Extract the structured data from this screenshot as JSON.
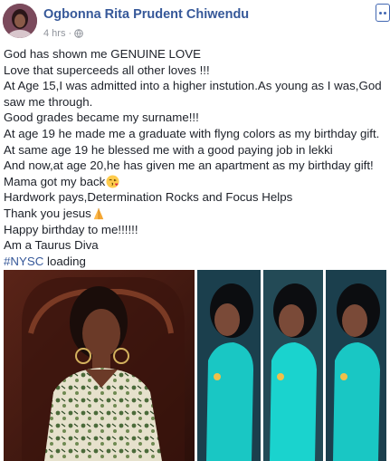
{
  "post": {
    "author": "Ogbonna Rita Prudent Chiwendu",
    "time": "4 hrs",
    "separator": "·",
    "lines": [
      "God has shown me GENUINE LOVE",
      "Love that superceeds all other loves !!!",
      "At Age 15,I was admitted into a higher instution.As young as I was,God saw me through.",
      "Good grades became my surname!!!",
      "At age 19 he made me a graduate with flyng colors as my birthday gift.",
      "At same age 19 he blessed me with a good paying job in lekki",
      "And now,at age 20,he has given me an apartment as my birthday gift!",
      "Mama got my back",
      "Hardwork pays,Determination Rocks and Focus Helps",
      "Thank you jesus",
      "Happy birthday to me!!!!!!",
      "Am a Taurus Diva"
    ],
    "hashtag": "#NYSC",
    "hashtag_suffix": " loading",
    "icons": {
      "audience": "globe-icon",
      "more": "more-options-icon",
      "emoji_back": "face-blowing-kiss-emoji",
      "emoji_thanks": "folded-hands-emoji"
    },
    "photos": [
      {
        "name": "photo-woman-floral-dress"
      },
      {
        "name": "photo-collage-teal-dress"
      }
    ]
  }
}
